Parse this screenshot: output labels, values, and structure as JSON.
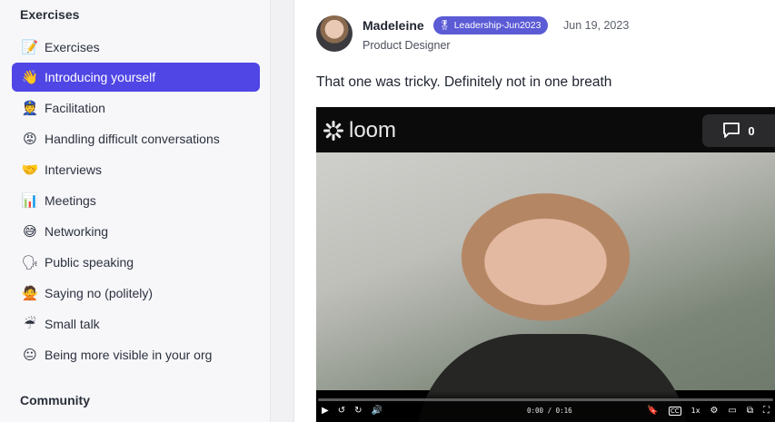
{
  "sidebar": {
    "exercises_title": "Exercises",
    "top_item": {
      "emoji": "📝",
      "label": "Exercises"
    },
    "items": [
      {
        "emoji": "👋",
        "label": "Introducing yourself",
        "active": true
      },
      {
        "emoji": "👮",
        "label": "Facilitation"
      },
      {
        "emoji": "😡",
        "label": "Handling difficult conversations"
      },
      {
        "emoji": "🤝",
        "label": "Interviews"
      },
      {
        "emoji": "📊",
        "label": "Meetings"
      },
      {
        "emoji": "😅",
        "label": "Networking"
      },
      {
        "emoji": "🗣",
        "label": "Public speaking"
      },
      {
        "emoji": "🙅",
        "label": "Saying no (politely)"
      },
      {
        "emoji": "☔",
        "label": "Small talk"
      },
      {
        "emoji": "😐",
        "label": "Being more visible in your org"
      }
    ],
    "community_title": "Community"
  },
  "post": {
    "author": "Madeleine",
    "badge": {
      "icon": "🎖",
      "label": "Leadership-Jun2023",
      "color": "#5b5bd6"
    },
    "date": "Jun 19, 2023",
    "role": "Product Designer",
    "text": "That one was tricky. Definitely not in one breath"
  },
  "video": {
    "brand": "loom",
    "comment_count": "0",
    "time": "0:00 / 0:16",
    "icons": {
      "left": [
        "play-icon",
        "rewind-icon",
        "forward-icon",
        "volume-icon"
      ],
      "right": [
        "bookmark-icon",
        "captions-icon",
        "speed-icon",
        "settings-icon",
        "theater-icon",
        "pip-icon",
        "fullscreen-icon"
      ]
    },
    "speed_label": "1x",
    "cc_label": "CC"
  },
  "colors": {
    "accent": "#4f46e5",
    "badge": "#5b5bd6"
  }
}
